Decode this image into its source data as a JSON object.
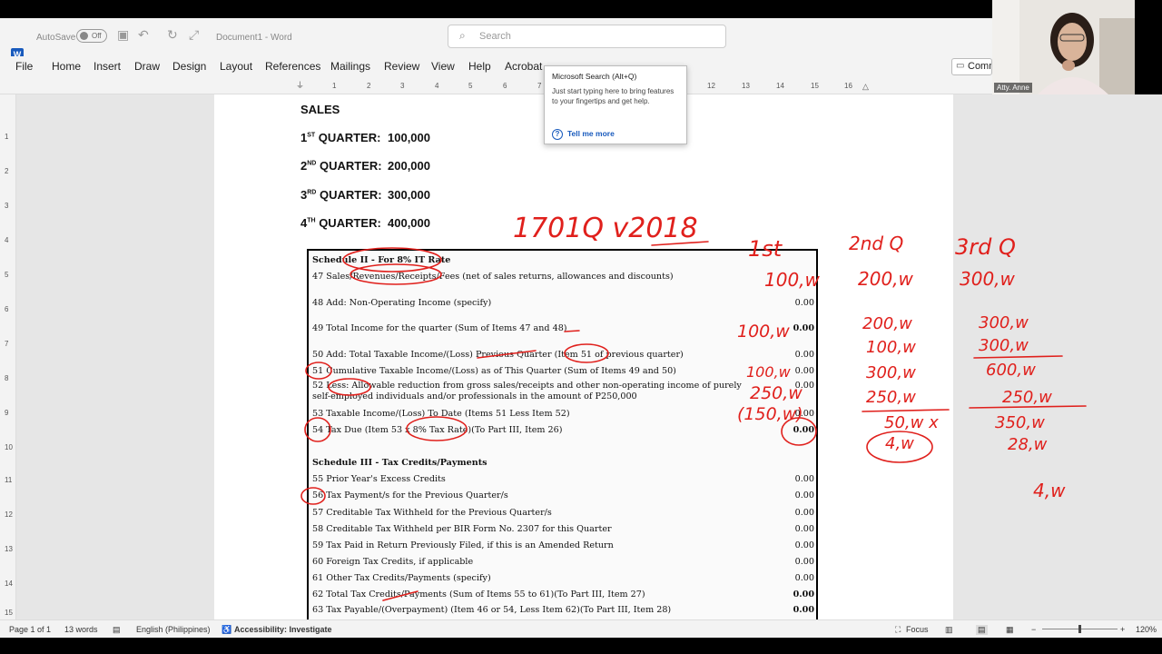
{
  "titlebar": {
    "autosave_label": "AutoSave",
    "autosave_state": "Off",
    "doc_title": "Document1  -  Word",
    "search_placeholder": "Search"
  },
  "menu": [
    "File",
    "Home",
    "Insert",
    "Draw",
    "Design",
    "Layout",
    "References",
    "Mailings",
    "Review",
    "View",
    "Help",
    "Acrobat"
  ],
  "comments_label": "Comm",
  "ruler_numbers": [
    "1",
    "2",
    "3",
    "4",
    "5",
    "6",
    "7",
    "8",
    "9",
    "10",
    "11",
    "12",
    "13",
    "14",
    "15",
    "16"
  ],
  "vruler_numbers": [
    "1",
    "2",
    "3",
    "4",
    "5",
    "6",
    "7",
    "8",
    "9",
    "10",
    "11",
    "12",
    "13",
    "14",
    "15"
  ],
  "tooltip": {
    "title": "Microsoft Search (Alt+Q)",
    "body": "Just start typing here to bring features to your fingertips and get help.",
    "link": "Tell me more"
  },
  "doc": {
    "heading": "SALES",
    "quarters": [
      {
        "num": "1",
        "sup": "ST",
        "label": " QUARTER:",
        "amount": "100,000"
      },
      {
        "num": "2",
        "sup": "ND",
        "label": " QUARTER:",
        "amount": "200,000"
      },
      {
        "num": "3",
        "sup": "RD",
        "label": " QUARTER:",
        "amount": "300,000"
      },
      {
        "num": "4",
        "sup": "TH",
        "label": " QUARTER:",
        "amount": "400,000"
      }
    ]
  },
  "form_rows": [
    {
      "text": "Schedule II - For 8% IT Rate",
      "value": "",
      "head": true
    },
    {
      "text": "47   Sales/Revenues/Receipts/Fees (net of sales returns, allowances and discounts)",
      "value": ""
    },
    {
      "text": "48   Add: Non-Operating Income (specify)",
      "value": "0.00"
    },
    {
      "text": "49 Total Income for the quarter (Sum of Items 47 and 48)",
      "value": "0.00",
      "bold": true
    },
    {
      "text": "50   Add: Total Taxable Income/(Loss) Previous Quarter (Item 51 of previous quarter)",
      "value": "0.00"
    },
    {
      "text": "51 Cumulative Taxable Income/(Loss) as of This Quarter (Sum of Items 49 and 50)",
      "value": "0.00"
    },
    {
      "text": "52   Less:  Allowable reduction from gross sales/receipts and other non-operating income of purely",
      "value": "0.00"
    },
    {
      "text": "self-employed individuals and/or professionals in the amount of P250,000",
      "value": ""
    },
    {
      "text": "53 Taxable Income/(Loss) To Date (Items 51 Less Item 52)",
      "value": "0.00"
    },
    {
      "text": "54 Tax Due (Item 53 x 8% Tax Rate)(To Part III, Item 26)",
      "value": "0.00",
      "bold": true
    },
    {
      "text": "Schedule III - Tax Credits/Payments",
      "value": "",
      "head": true
    },
    {
      "text": "55   Prior Year's Excess Credits",
      "value": "0.00"
    },
    {
      "text": "56   Tax Payment/s for the Previous Quarter/s",
      "value": "0.00"
    },
    {
      "text": "57   Creditable Tax Withheld for the Previous Quarter/s",
      "value": "0.00"
    },
    {
      "text": "58   Creditable Tax Withheld per BIR Form No. 2307 for this Quarter",
      "value": "0.00"
    },
    {
      "text": "59   Tax Paid in Return Previously Filed, if this is an Amended Return",
      "value": "0.00"
    },
    {
      "text": "60   Foreign Tax Credits, if applicable",
      "value": "0.00"
    },
    {
      "text": "61   Other Tax Credits/Payments (specify)",
      "value": "0.00"
    },
    {
      "text": "62 Total Tax Credits/Payments (Sum of Items 55 to 61)(To Part III, Item 27)",
      "value": "0.00",
      "bold": true
    },
    {
      "text": "63 Tax Payable/(Overpayment) (Item 46 or 54, Less Item 62)(To Part III, Item 28)",
      "value": "0.00",
      "bold": true
    }
  ],
  "ink": {
    "color": "#e0201c",
    "form_title": "1701Q v2018",
    "col_1st": [
      "1st",
      "100,w",
      "100,w",
      "100,w",
      "250,w",
      "(150,w)"
    ],
    "col_2nd": [
      "2nd Q",
      "200,w",
      "200,w",
      "100,w",
      "300,w",
      "250,w",
      "50,w x",
      "4,w"
    ],
    "col_3rd": [
      "3rd Q",
      "300,w",
      "300,w",
      "300,w",
      "600,w",
      "250,w",
      "350,w",
      "28,w",
      "4,w"
    ]
  },
  "webcam_name": "Atty. Anne",
  "status": {
    "page": "Page 1 of 1",
    "words": "13 words",
    "language": "English (Philippines)",
    "accessibility": "Accessibility: Investigate",
    "focus": "Focus",
    "zoom": "120%"
  }
}
